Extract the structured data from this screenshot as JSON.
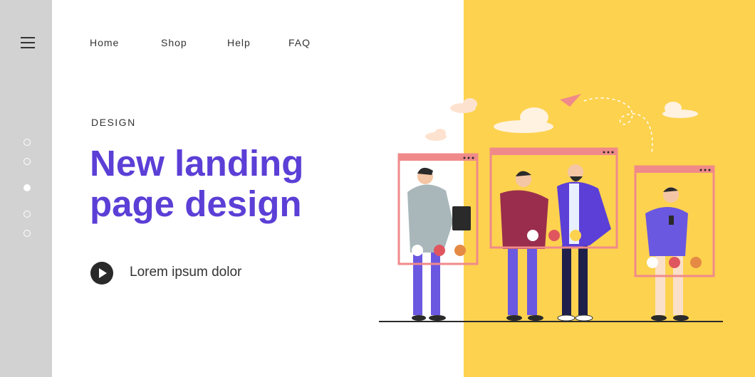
{
  "nav": {
    "items": [
      {
        "label": "Home"
      },
      {
        "label": "Shop"
      },
      {
        "label": "Help"
      },
      {
        "label": "FAQ"
      }
    ]
  },
  "hero": {
    "eyebrow": "DESIGN",
    "headline": "New landing page design",
    "cta_text": "Lorem ipsum dolor"
  },
  "pagination": {
    "count": 5,
    "active_index": 2
  },
  "colors": {
    "sidebar": "#d2d2d2",
    "accent_panel": "#fdd24f",
    "headline": "#5b3fd6",
    "video_frame": "#f08a8a"
  },
  "icons": [
    "menu-icon",
    "play-icon",
    "speaker-icon",
    "hang-up-icon",
    "mute-icon",
    "paper-plane-icon",
    "cloud-icon"
  ]
}
